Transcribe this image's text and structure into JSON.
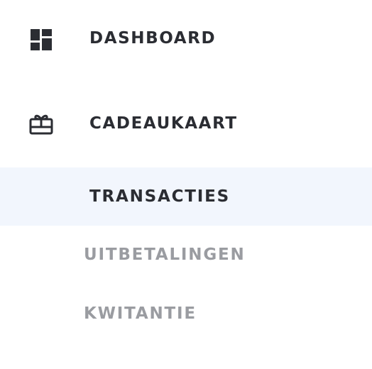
{
  "nav": {
    "items": [
      {
        "label": "DASHBOARD",
        "icon": "dashboard-icon"
      },
      {
        "label": "CADEAUKAART",
        "icon": "gift-card-icon"
      }
    ],
    "sub_items": [
      {
        "label": "TRANSACTIES",
        "active": true
      },
      {
        "label": "UITBETALINGEN",
        "active": false
      },
      {
        "label": "KWITANTIE",
        "active": false
      }
    ]
  },
  "colors": {
    "text_primary": "#2b2d33",
    "text_muted": "#9a9ca1",
    "active_background": "#f2f6fd",
    "background": "#ffffff"
  }
}
